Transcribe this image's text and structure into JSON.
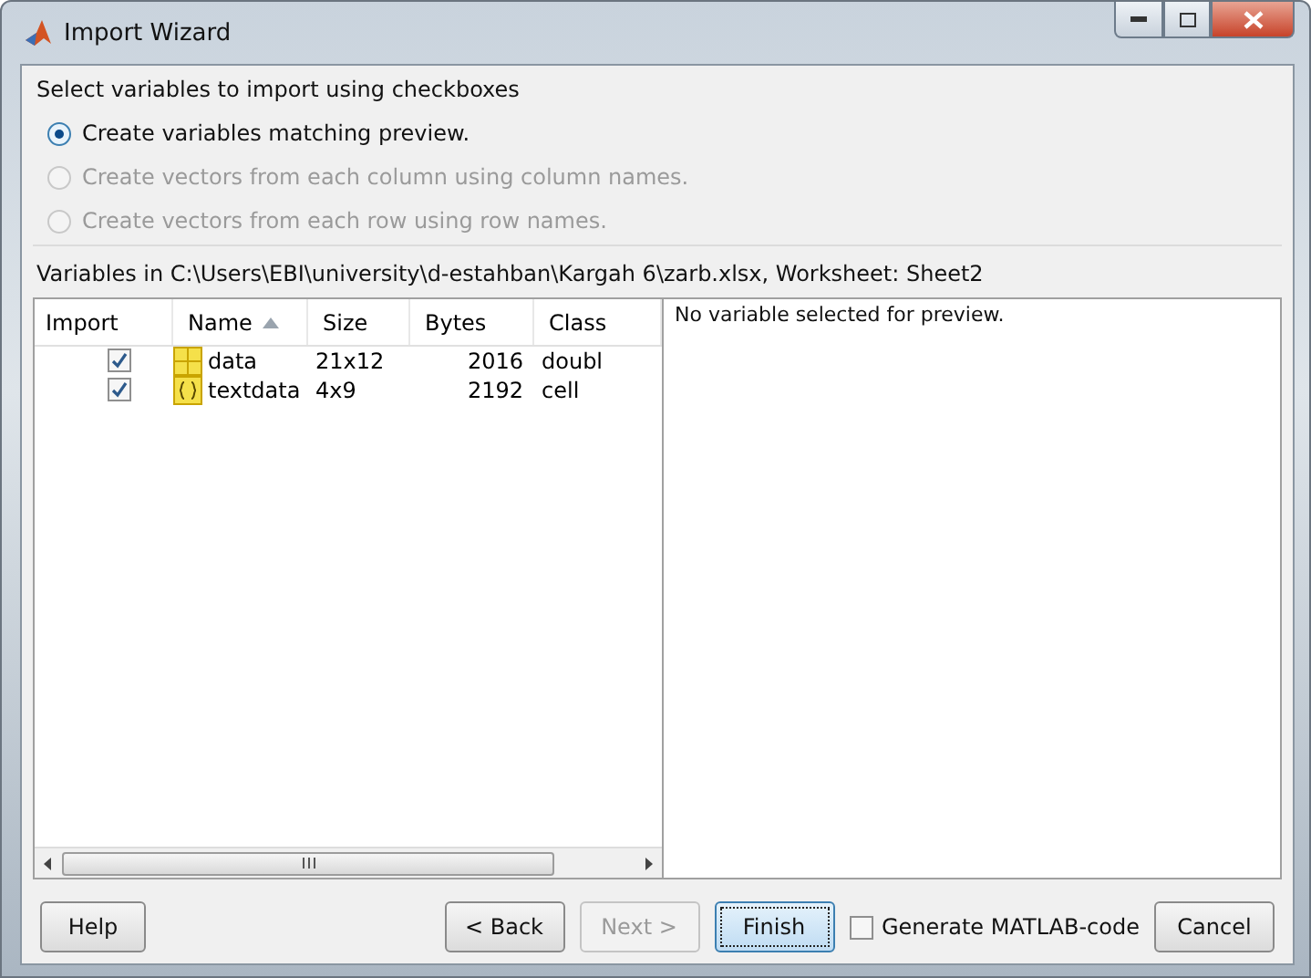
{
  "window": {
    "title": "Import Wizard"
  },
  "options_group": {
    "title": "Select variables to import using checkboxes",
    "options": [
      {
        "label": "Create variables matching preview.",
        "selected": true,
        "disabled": false
      },
      {
        "label": "Create vectors from each column using column names.",
        "selected": false,
        "disabled": true
      },
      {
        "label": "Create vectors from each row using row names.",
        "selected": false,
        "disabled": true
      }
    ]
  },
  "variables_label": "Variables in C:\\Users\\EBI\\university\\d-estahban\\Kargah 6\\zarb.xlsx, Worksheet: Sheet2",
  "table": {
    "columns": [
      {
        "label": "Import",
        "sorted": false
      },
      {
        "label": "Name",
        "sorted": true
      },
      {
        "label": "Size",
        "sorted": false
      },
      {
        "label": "Bytes",
        "sorted": false
      },
      {
        "label": "Class",
        "sorted": false
      }
    ],
    "rows": [
      {
        "checked": true,
        "kind": "matrix",
        "name": "data",
        "size": "21x12",
        "bytes": "2016",
        "class": "doubl"
      },
      {
        "checked": true,
        "kind": "cell",
        "name": "textdata",
        "size": "4x9",
        "bytes": "2192",
        "class": "cell"
      }
    ]
  },
  "preview": {
    "message": "No variable selected for preview."
  },
  "footer": [
    {
      "kind": "button",
      "label": "Help",
      "disabled": false,
      "default": false
    },
    {
      "kind": "spacer"
    },
    {
      "kind": "button",
      "label": "< Back",
      "disabled": false,
      "default": false
    },
    {
      "kind": "button",
      "label": "Next >",
      "disabled": true,
      "default": false
    },
    {
      "kind": "button",
      "label": "Finish",
      "disabled": false,
      "default": true
    },
    {
      "kind": "checkbox",
      "label": "Generate MATLAB-code",
      "checked": false
    },
    {
      "kind": "button",
      "label": "Cancel",
      "disabled": false,
      "default": false
    }
  ]
}
